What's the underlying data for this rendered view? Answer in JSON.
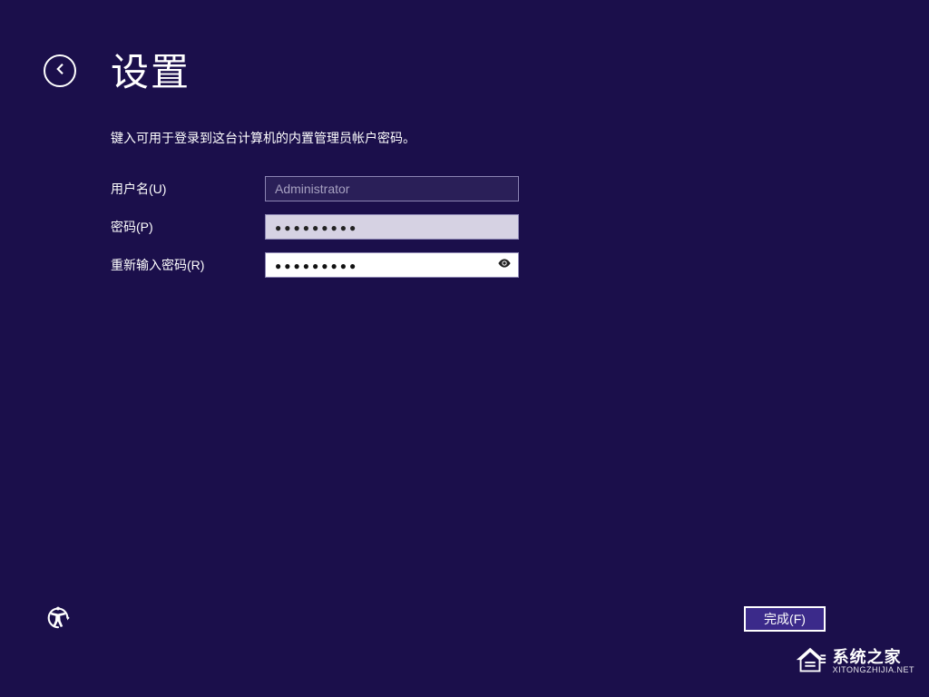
{
  "title": "设置",
  "instruction": "键入可用于登录到这台计算机的内置管理员帐户密码。",
  "form": {
    "username_label": "用户名(U)",
    "username_value": "Administrator",
    "password_label": "密码(P)",
    "password_dots": "●●●●●●●●●",
    "confirm_label": "重新输入密码(R)",
    "confirm_dots": "●●●●●●●●●"
  },
  "finish_label": "完成(F)",
  "watermark": {
    "main": "系统之家",
    "sub": "XITONGZHIJIA.NET"
  }
}
